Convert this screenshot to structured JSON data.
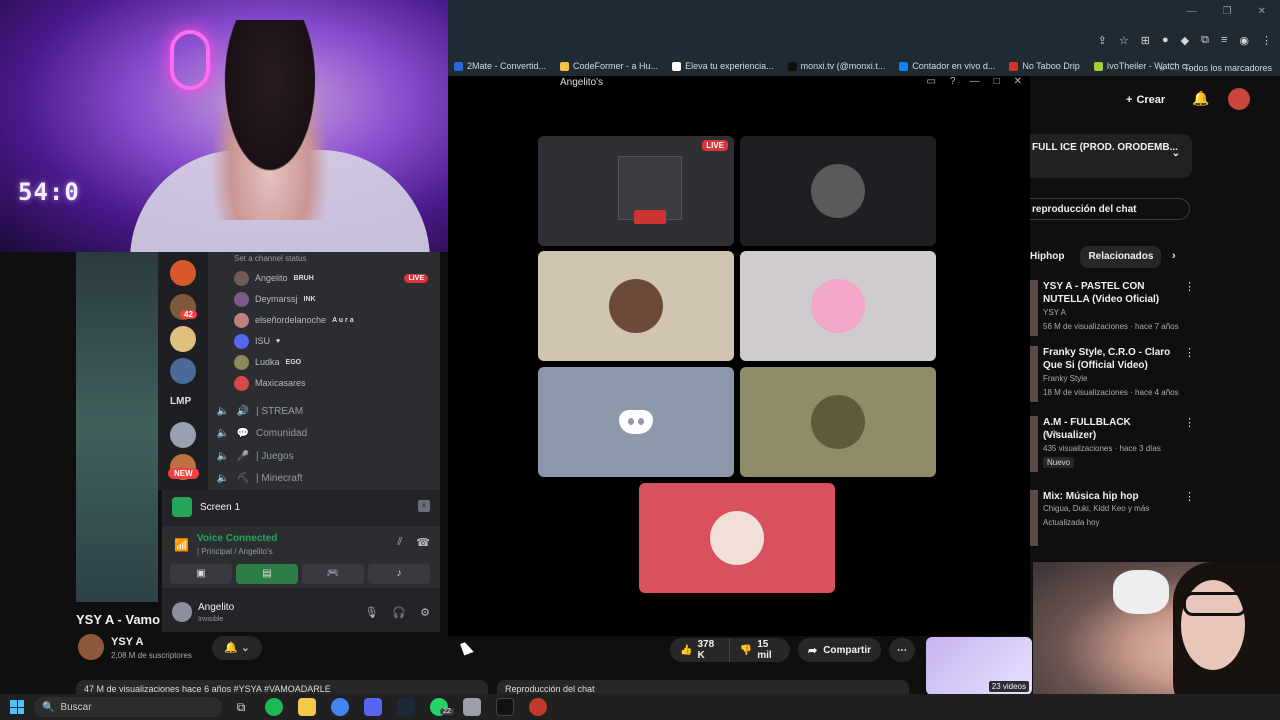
{
  "webcam": {
    "clock": "54:0"
  },
  "browser": {
    "bookmarks": [
      {
        "label": "2Mate - Convertid...",
        "color": "#2a66d9"
      },
      {
        "label": "CodeFormer - a Hu...",
        "color": "#f5c542"
      },
      {
        "label": "Eleva tu experiencia...",
        "color": "#ffffff"
      },
      {
        "label": "monxi.tv (@monxi.t...",
        "color": "#111111"
      },
      {
        "label": "Contador en vivo d...",
        "color": "#0a84ff"
      },
      {
        "label": "No Taboo Drip",
        "color": "#d93025"
      },
      {
        "label": "IvoTheiler - Watch c...",
        "color": "#a3d12d"
      }
    ],
    "bookmarks_more": "»",
    "all_bookmarks": "Todos los marcadores"
  },
  "discord": {
    "channel_status": "Set a channel status",
    "voice_users": [
      {
        "name": "Angelito",
        "tag": "BRUH",
        "live": true,
        "color": "#6d5d55"
      },
      {
        "name": "Deymarssj",
        "tag": "INK",
        "live": false,
        "color": "#7a5a8a"
      },
      {
        "name": "elseñordelanoche",
        "tag": "A u r a",
        "live": false,
        "color": "#c08080"
      },
      {
        "name": "ISU",
        "tag": "♥",
        "live": false,
        "color": "#5865f2"
      },
      {
        "name": "Ludka",
        "tag": "EGO",
        "live": false,
        "color": "#8a8a5a"
      },
      {
        "name": "Maxicasares",
        "tag": "",
        "live": false,
        "color": "#d44a4a"
      }
    ],
    "live_label": "LIVE",
    "channels": [
      {
        "icon": "🔊",
        "label": "| STREAM"
      },
      {
        "icon": "💬",
        "label": "Comunidad"
      },
      {
        "icon": "🎤",
        "label": "| Juegos"
      },
      {
        "icon": "⛏",
        "label": "| Minecraft"
      }
    ],
    "rail": {
      "badge_count": "42",
      "lmp": "LMP",
      "new": "NEW"
    },
    "screen_label": "Screen 1",
    "voice_connected": "Voice Connected",
    "voice_sub": "| Principal / Angelito's",
    "user": {
      "name": "Angelito",
      "status": "Invisible"
    },
    "stream_title": "Angelito's"
  },
  "youtube": {
    "create_label": "Crear",
    "playlist_title": "FULL ICE (PROD. ORODEMB...",
    "chat_replay": "reproducción del chat",
    "chips": [
      "Hiphop",
      "Relacionados"
    ],
    "recommendations": [
      {
        "title": "YSY A - PASTEL CON NUTELLA (Video Oficial)",
        "channel": "YSY A",
        "views": "56 M de visualizaciones · hace 7 años",
        "new": ""
      },
      {
        "title": "Franky Style, C.R.O - Claro Que Si (Official Video)",
        "channel": "Franky Style",
        "views": "18 M de visualizaciones · hace 4 años",
        "new": ""
      },
      {
        "title": "A.M - FULLBLACK (Visualizer)",
        "channel": "A.M",
        "views": "435 visualizaciones · hace 3 días",
        "new": "Nuevo"
      },
      {
        "title": "Mix: Música hip hop",
        "channel": "Chigua, Duki, Kidd Keo y más",
        "views": "Actualizada hoy",
        "new": ""
      }
    ],
    "video_title": "YSY A - Vamo",
    "channel_name": "YSY A",
    "subscribers": "2,08 M de suscriptores",
    "likes": "378 K",
    "dislikes": "15 mil",
    "share": "Compartir",
    "more": "⋯",
    "videos_count": "23 videos",
    "description": "47 M de visualizaciones  hace 6 años  #YSYA #VAMOADARLE",
    "chat_replay_bottom": "Reproducción del chat"
  },
  "taskbar": {
    "search": "Buscar",
    "whatsapp_badge": "22"
  }
}
